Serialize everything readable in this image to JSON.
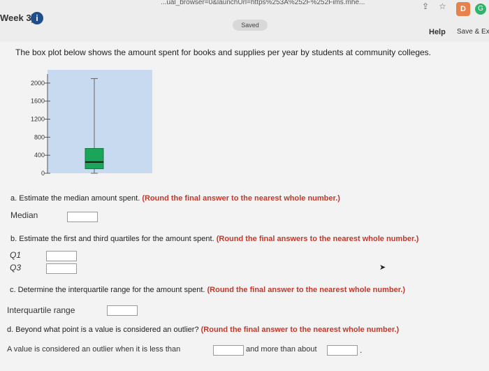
{
  "browser": {
    "url_text": "...ual_browser=0&launchUrl=https%253A%252F%252Fims.mhe...",
    "share_icon": "share-icon",
    "star_icon": "star-icon",
    "extension1_label": "D",
    "extension2_label": "G"
  },
  "header": {
    "week_title": "Week 3)",
    "info_glyph": "i",
    "saved_badge": "Saved",
    "help_label": "Help",
    "save_exit_label": "Save & Ex"
  },
  "question": {
    "intro": "The box plot below shows the amount spent for books and supplies per year by students at community colleges.",
    "a": {
      "text": "a. Estimate the median amount spent. ",
      "hint": "(Round the final answer to the nearest whole number.)",
      "median_label": "Median",
      "median_value": ""
    },
    "b": {
      "text": "b. Estimate the first and third quartiles for the amount spent. ",
      "hint": "(Round the final answers to the nearest whole number.)",
      "q1_label": "Q1",
      "q3_label": "Q3",
      "q1_value": "",
      "q3_value": ""
    },
    "c": {
      "text": "c. Determine the interquartile range for the amount spent. ",
      "hint": "(Round the final answer to the nearest whole number.)",
      "iqr_label": "Interquartile range",
      "iqr_value": ""
    },
    "d": {
      "text": "d. Beyond what point is a value is considered an outlier? ",
      "hint": "(Round the final answer to the nearest whole number.)",
      "outlier_prefix": "A value is considered an outlier when it is less than",
      "outlier_middle": "and more than about",
      "outlier_suffix": ".",
      "lower_value": "",
      "upper_value": ""
    }
  },
  "chart_data": {
    "type": "box",
    "ylim": [
      0,
      2200
    ],
    "ticks": [
      0,
      400,
      800,
      1200,
      1600,
      2000
    ],
    "tick_labels": [
      "0",
      "400",
      "800",
      "1200",
      "1600",
      "2000"
    ],
    "min": 0,
    "q1": 100,
    "median": 250,
    "q3": 550,
    "max": 2100,
    "plot_bg": "#c8daef",
    "box_color": "#1aa55a",
    "median_color": "#111111"
  }
}
